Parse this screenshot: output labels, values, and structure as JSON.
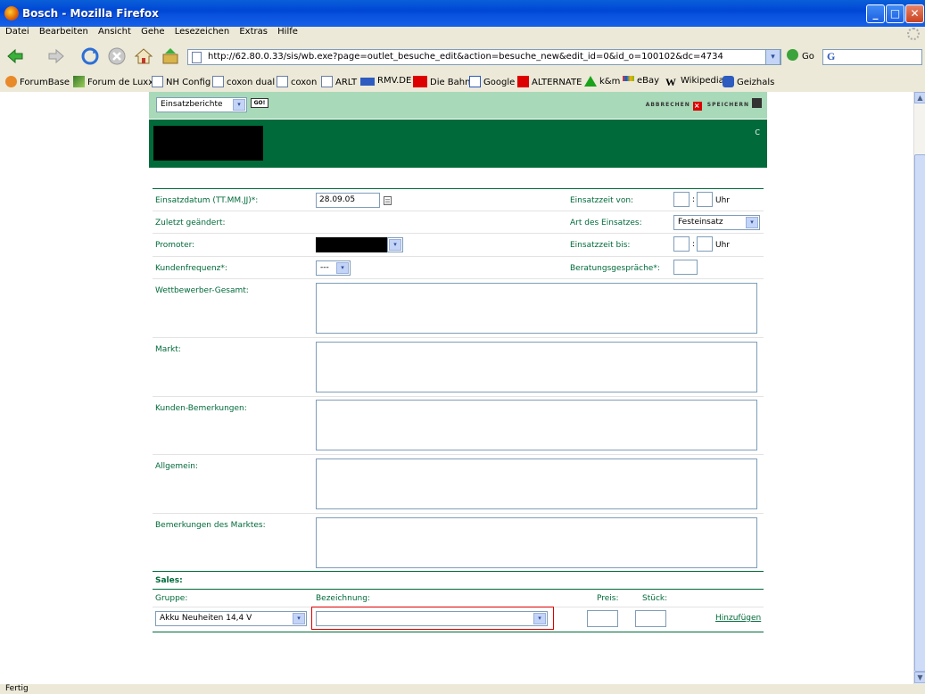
{
  "window": {
    "title": "Bosch - Mozilla Firefox",
    "min": "_",
    "max": "□",
    "close": "✕"
  },
  "menu": [
    "Datei",
    "Bearbeiten",
    "Ansicht",
    "Gehe",
    "Lesezeichen",
    "Extras",
    "Hilfe"
  ],
  "nav": {
    "url": "http://62.80.0.33/sis/wb.exe?page=outlet_besuche_edit&action=besuche_new&edit_id=0&id_o=100102&dc=4734",
    "go_label": "Go",
    "search_value": "G",
    "url_dropdown": "▾"
  },
  "bookmarks": [
    "ForumBase",
    "Forum de Luxx",
    "NH Config",
    "coxon dual",
    "coxon",
    "ARLT",
    "RMV.DE",
    "Die Bahn",
    "Google",
    "ALTERNATE",
    "k&m",
    "eBay",
    "Wikipedia",
    "Geizhals"
  ],
  "app": {
    "module_select": "Einsatzberichte",
    "go": "GO!",
    "cancel": "ABBRECHEN",
    "save": "SPEICHERN",
    "banner_c": "C",
    "dd": "▾",
    "cal": "",
    "fields": {
      "einsatzdatum_label": "Einsatzdatum (TT.MM.JJ)*:",
      "einsatzdatum_value": "28.09.05",
      "einsatzzeit_von_label": "Einsatzzeit von:",
      "time_sep": ":",
      "uhr": "Uhr",
      "zuletzt_label": "Zuletzt geändert:",
      "art_label": "Art des Einsatzes:",
      "art_value": "Festeinsatz",
      "promoter_label": "Promoter:",
      "einsatzzeit_bis_label": "Einsatzzeit bis:",
      "kundenfrequenz_label": "Kundenfrequenz*:",
      "kundenfrequenz_value": "---",
      "beratung_label": "Beratungsgespräche*:",
      "wettbewerber_label": "Wettbewerber-Gesamt:",
      "markt_label": "Markt:",
      "kunden_bem_label": "Kunden-Bemerkungen:",
      "allgemein_label": "Allgemein:",
      "bem_marktes_label": "Bemerkungen des Marktes:"
    },
    "sales": {
      "title": "Sales:",
      "gruppe_label": "Gruppe:",
      "bezeichnung_label": "Bezeichnung:",
      "preis_label": "Preis:",
      "stueck_label": "Stück:",
      "gruppe_value": "Akku Neuheiten 14,4 V",
      "bezeichnung_value": "",
      "add_link": "Hinzufügen"
    }
  },
  "status": "Fertig",
  "scroll": {
    "up": "▲",
    "down": "▼",
    "grip": "≡"
  }
}
